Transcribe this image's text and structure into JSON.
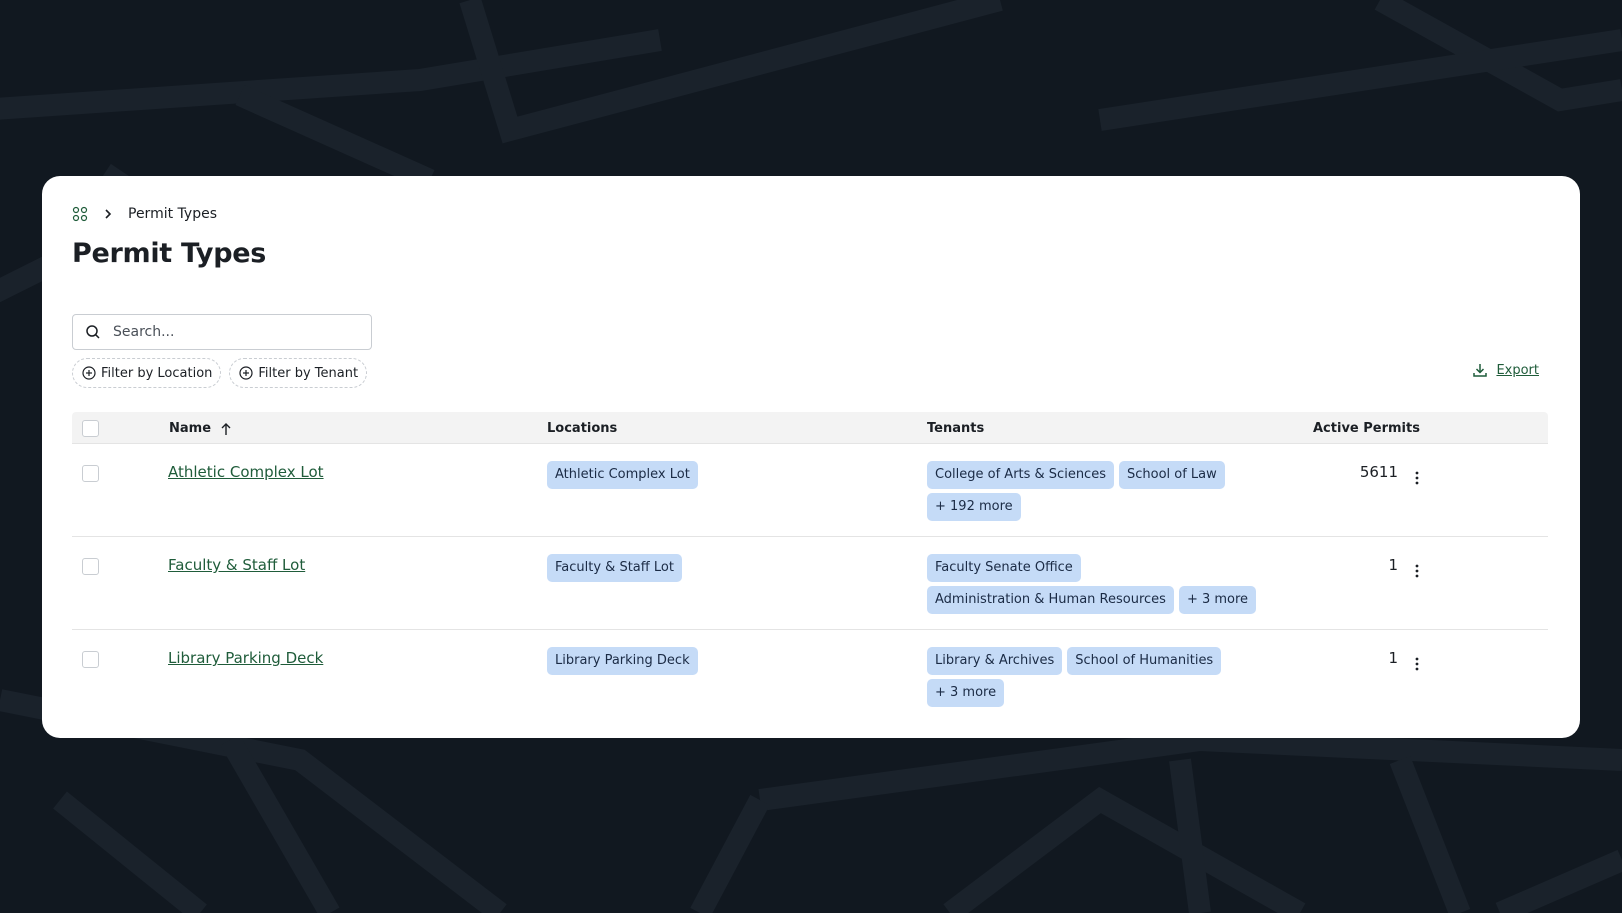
{
  "breadcrumb": {
    "current": "Permit Types"
  },
  "page": {
    "title": "Permit Types"
  },
  "search": {
    "placeholder": "Search..."
  },
  "filters": [
    {
      "label": "Filter by Location"
    },
    {
      "label": "Filter by Tenant"
    }
  ],
  "export": {
    "label": "Export"
  },
  "table": {
    "headers": {
      "name": "Name",
      "locations": "Locations",
      "tenants": "Tenants",
      "active_permits": "Active Permits"
    },
    "rows": [
      {
        "name": "Athletic Complex Lot",
        "location": "Athletic Complex Lot",
        "tenants": [
          "College of Arts & Sciences",
          "School of Law",
          "+ 192 more"
        ],
        "active_permits": "5611"
      },
      {
        "name": "Faculty & Staff Lot",
        "location": "Faculty & Staff Lot",
        "tenants": [
          "Faculty Senate Office",
          "Administration & Human Resources",
          "+ 3 more"
        ],
        "active_permits": "1"
      },
      {
        "name": "Library Parking Deck",
        "location": "Library Parking Deck",
        "tenants": [
          "Library & Archives",
          "School of Humanities",
          "+ 3 more"
        ],
        "active_permits": "1"
      }
    ]
  },
  "colors": {
    "background": "#111820",
    "accent": "#1f5c3a",
    "tag": "#c5dbf7"
  },
  "icons": [
    "home-grid-icon",
    "chevron-right-icon",
    "search-icon",
    "plus-circle-icon",
    "download-icon",
    "sort-arrow-up-icon",
    "more-vertical-icon"
  ]
}
